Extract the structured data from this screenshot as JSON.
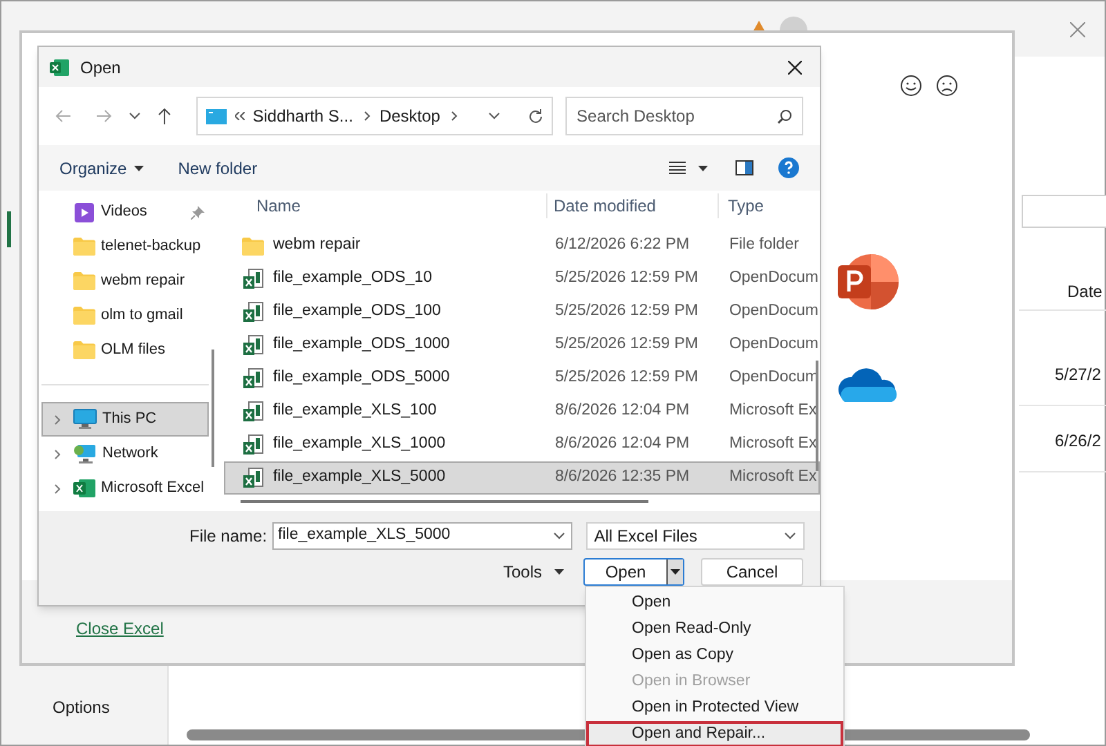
{
  "app_window": {
    "column_header": "Date",
    "row_dates": [
      "5/27/2",
      "6/26/2"
    ],
    "options_label": "Options"
  },
  "startup_panel": {
    "close_link": "Close Excel"
  },
  "dialog": {
    "title": "Open",
    "breadcrumb": [
      "Siddharth S...",
      "Desktop"
    ],
    "search": {
      "placeholder": "Search Desktop"
    },
    "toolbar": {
      "organize": "Organize",
      "new_folder": "New folder"
    },
    "nav_pane": [
      {
        "label": "Videos",
        "kind": "videos",
        "pinned": true,
        "selected": false
      },
      {
        "label": "telenet-backup",
        "kind": "folder",
        "pinned": false,
        "selected": false
      },
      {
        "label": "webm repair",
        "kind": "folder",
        "pinned": false,
        "selected": false
      },
      {
        "label": "olm to gmail",
        "kind": "folder",
        "pinned": false,
        "selected": false
      },
      {
        "label": "OLM files",
        "kind": "folder",
        "pinned": false,
        "selected": false
      },
      {
        "label": "This PC",
        "kind": "pc",
        "pinned": false,
        "selected": true
      },
      {
        "label": "Network",
        "kind": "network",
        "pinned": false,
        "selected": false
      },
      {
        "label": "Microsoft Excel",
        "kind": "app",
        "pinned": false,
        "selected": false
      }
    ],
    "columns": [
      "Name",
      "Date modified",
      "Type"
    ],
    "rows": [
      {
        "name": "webm repair",
        "date": "6/12/2026 6:22 PM",
        "type": "File folder",
        "kind": "folder",
        "selected": false
      },
      {
        "name": "file_example_ODS_10",
        "date": "5/25/2026 12:59 PM",
        "type": "OpenDocum",
        "kind": "sheet",
        "selected": false
      },
      {
        "name": "file_example_ODS_100",
        "date": "5/25/2026 12:59 PM",
        "type": "OpenDocum",
        "kind": "sheet",
        "selected": false
      },
      {
        "name": "file_example_ODS_1000",
        "date": "5/25/2026 12:59 PM",
        "type": "OpenDocum",
        "kind": "sheet",
        "selected": false
      },
      {
        "name": "file_example_ODS_5000",
        "date": "5/25/2026 12:59 PM",
        "type": "OpenDocum",
        "kind": "sheet",
        "selected": false
      },
      {
        "name": "file_example_XLS_100",
        "date": "8/6/2026 12:04 PM",
        "type": "Microsoft Ex",
        "kind": "sheet",
        "selected": false
      },
      {
        "name": "file_example_XLS_1000",
        "date": "8/6/2026 12:04 PM",
        "type": "Microsoft Ex",
        "kind": "sheet",
        "selected": false
      },
      {
        "name": "file_example_XLS_5000",
        "date": "8/6/2026 12:35 PM",
        "type": "Microsoft Ex",
        "kind": "sheet",
        "selected": true
      }
    ],
    "file_name_label": "File name:",
    "file_name": "file_example_XLS_5000",
    "file_type": "All Excel Files",
    "tools": "Tools",
    "open": "Open",
    "cancel": "Cancel"
  },
  "open_menu": [
    {
      "label": "Open",
      "disabled": false,
      "selected": false
    },
    {
      "label": "Open Read-Only",
      "disabled": false,
      "selected": false
    },
    {
      "label": "Open as Copy",
      "disabled": false,
      "selected": false
    },
    {
      "label": "Open in Browser",
      "disabled": true,
      "selected": false
    },
    {
      "label": "Open in Protected View",
      "disabled": false,
      "selected": false
    },
    {
      "label": "Open and Repair...",
      "disabled": false,
      "selected": true
    }
  ]
}
